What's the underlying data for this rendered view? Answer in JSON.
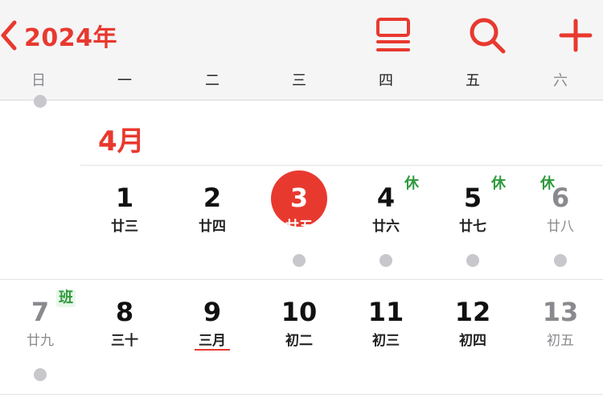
{
  "header": {
    "back_label": "2024年",
    "icons": [
      "list-icon",
      "search-icon",
      "plus-icon"
    ],
    "accent": "#e8392f"
  },
  "weekdays": [
    "日",
    "一",
    "二",
    "三",
    "四",
    "五",
    "六"
  ],
  "month": "4月",
  "week1": [
    {
      "num": "1",
      "lunar": "廿三"
    },
    {
      "num": "2",
      "lunar": "廿四"
    },
    {
      "num": "3",
      "lunar": "廿五",
      "today": true
    },
    {
      "num": "4",
      "lunar": "廿六",
      "badge": "休"
    },
    {
      "num": "5",
      "lunar": "廿七",
      "badge": "休"
    },
    {
      "num": "6",
      "lunar": "廿八",
      "badge": "休"
    }
  ],
  "week2": [
    {
      "num": "7",
      "lunar": "廿九",
      "badge": "班"
    },
    {
      "num": "8",
      "lunar": "三十"
    },
    {
      "num": "9",
      "lunar": "三月"
    },
    {
      "num": "10",
      "lunar": "初二"
    },
    {
      "num": "11",
      "lunar": "初三"
    },
    {
      "num": "12",
      "lunar": "初四"
    },
    {
      "num": "13",
      "lunar": "初五"
    }
  ],
  "colors": {
    "holiday_badge": "#2e9a3d",
    "event_dot": "#c7c7cc",
    "weekend_text": "#8a8a8e"
  }
}
